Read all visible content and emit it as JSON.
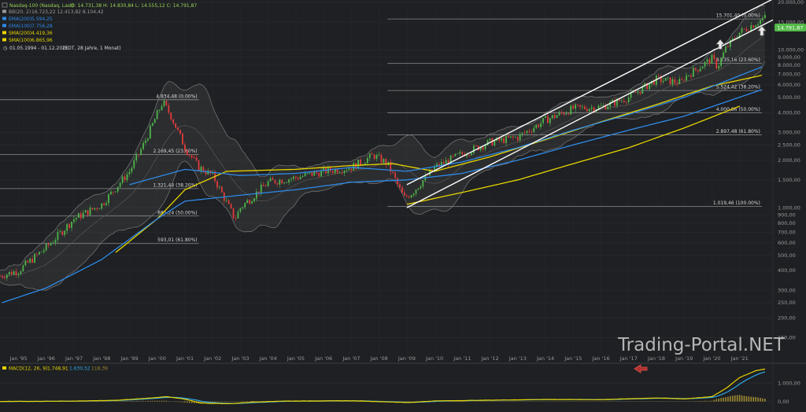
{
  "legend": {
    "title": "Nasdaq-100 (Nasdaq, Last)",
    "ohlc": "O: 14.731,38  H: 14.830,84  L: 14.555,12  C: 14.791,87",
    "indicators": [
      {
        "label": "BB(20, 2)",
        "value": "16.723,22  12.413,82  8.104,42",
        "color": "#9a9a9a"
      },
      {
        "label": "EMA(200)",
        "value": "5.594,25",
        "color": "#2f8ae8"
      },
      {
        "label": "EMA(100)",
        "value": "7.756,28",
        "color": "#2f8ae8"
      },
      {
        "label": "SMA(200)",
        "value": "4.419,36",
        "color": "#e8d400"
      },
      {
        "label": "SMA(100)",
        "value": "6.865,96",
        "color": "#e8d400"
      }
    ],
    "period": "01.05.1994 - 01.12.2021",
    "period_note": "(EDT, 28 Jahre, 1 Monat)"
  },
  "last_price": "14.791,87",
  "watermark": "Trading-Portal.NET",
  "macd": {
    "label": "MACD(12, 26, 9)",
    "macd_value": "1.748,91",
    "signal_value": "1.630,52",
    "hist_value": "118,39",
    "axis": [
      {
        "label": "1.000,00",
        "value": 1000
      },
      {
        "label": "0,00",
        "value": 0
      }
    ],
    "ylim": [
      -400,
      1900
    ]
  },
  "chart_data": {
    "type": "candlestick",
    "scale": "log",
    "ylim": [
      120,
      20000
    ],
    "xlim": [
      1994.33,
      2022.2
    ],
    "x_ticks": [
      "Jan '95",
      "Jan '96",
      "Jan '97",
      "Jan '98",
      "Jan '99",
      "Jan '00",
      "Jan '01",
      "Jan '02",
      "Jan '03",
      "Jan '04",
      "Jan '05",
      "Jan '06",
      "Jan '07",
      "Jan '08",
      "Jan '09",
      "Jan '10",
      "Jan '11",
      "Jan '12",
      "Jan '13",
      "Jan '14",
      "Jan '15",
      "Jan '16",
      "Jan '17",
      "Jan '18",
      "Jan '19",
      "Jan '20",
      "Jan '21"
    ],
    "y_ticks": [
      {
        "label": "20.000,00",
        "value": 20000
      },
      {
        "label": "15.000,00",
        "value": 15000
      },
      {
        "label": "10.000,00",
        "value": 10000
      },
      {
        "label": "9.000,00",
        "value": 9000
      },
      {
        "label": "8.000,00",
        "value": 8000
      },
      {
        "label": "7.000,00",
        "value": 7000
      },
      {
        "label": "6.000,00",
        "value": 6000
      },
      {
        "label": "5.000,00",
        "value": 5000
      },
      {
        "label": "4.000,00",
        "value": 4000
      },
      {
        "label": "3.000,00",
        "value": 3000
      },
      {
        "label": "2.500,00",
        "value": 2500
      },
      {
        "label": "2.000,00",
        "value": 2000
      },
      {
        "label": "1.500,00",
        "value": 1500
      },
      {
        "label": "1.000,00",
        "value": 1000
      },
      {
        "label": "900,00",
        "value": 900
      },
      {
        "label": "800,00",
        "value": 800
      },
      {
        "label": "700,00",
        "value": 700
      },
      {
        "label": "600,00",
        "value": 600
      },
      {
        "label": "500,00",
        "value": 500
      },
      {
        "label": "400,00",
        "value": 400
      },
      {
        "label": "300,00",
        "value": 300
      },
      {
        "label": "250,00",
        "value": 250
      },
      {
        "label": "200,00",
        "value": 200
      },
      {
        "label": "150,00",
        "value": 150
      }
    ],
    "fib_sets": [
      {
        "start": 1994.33,
        "end": 2001.5,
        "levels": [
          {
            "label": "4.834,48 (0.00%)",
            "value": 4834.48
          },
          {
            "label": "2.169,45 (23.60%)",
            "value": 2169.45
          },
          {
            "label": "1.321,48 (38.20%)",
            "value": 1321.48
          },
          {
            "label": "885,24 (50.00%)",
            "value": 885.24
          },
          {
            "label": "593,01 (61.80%)",
            "value": 593.01
          }
        ]
      },
      {
        "start": 2008.3,
        "end": 2021.8,
        "levels": [
          {
            "label": "15.701,40 (0.00%)",
            "value": 15701.4
          },
          {
            "label": "8.235,16 (23.60%)",
            "value": 8235.16
          },
          {
            "label": "5.524,42 (38.20%)",
            "value": 5524.42
          },
          {
            "label": "4.000,86 (50.00%)",
            "value": 4000.86
          },
          {
            "label": "2.897,48 (61.80%)",
            "value": 2897.48
          },
          {
            "label": "1.019,46 (100.00%)",
            "value": 1019.46
          }
        ]
      }
    ],
    "price_path": [
      [
        1994.33,
        370
      ],
      [
        1995,
        400
      ],
      [
        1996,
        560
      ],
      [
        1997,
        850
      ],
      [
        1998,
        1050
      ],
      [
        1999,
        1700
      ],
      [
        1999.5,
        2500
      ],
      [
        2000.2,
        4700
      ],
      [
        2000.5,
        3800
      ],
      [
        2001,
        2400
      ],
      [
        2001.5,
        1800
      ],
      [
        2002,
        1600
      ],
      [
        2002.8,
        850
      ],
      [
        2003,
        1000
      ],
      [
        2004,
        1450
      ],
      [
        2005,
        1550
      ],
      [
        2006,
        1700
      ],
      [
        2007,
        1800
      ],
      [
        2007.8,
        2150
      ],
      [
        2008.3,
        1900
      ],
      [
        2008.9,
        1150
      ],
      [
        2009.2,
        1250
      ],
      [
        2010,
        1800
      ],
      [
        2011,
        2200
      ],
      [
        2012,
        2600
      ],
      [
        2013,
        2800
      ],
      [
        2014,
        3600
      ],
      [
        2015,
        4250
      ],
      [
        2016,
        4350
      ],
      [
        2017,
        5000
      ],
      [
        2018,
        6500
      ],
      [
        2018.9,
        6200
      ],
      [
        2019,
        6700
      ],
      [
        2020,
        8800
      ],
      [
        2020.2,
        7800
      ],
      [
        2020.5,
        10200
      ],
      [
        2021,
        12900
      ],
      [
        2021.9,
        16000
      ]
    ],
    "series": [
      {
        "name": "SMA(200)",
        "color": "#e8d400",
        "points": [
          [
            2009,
            1050
          ],
          [
            2011,
            1250
          ],
          [
            2013,
            1500
          ],
          [
            2015,
            1900
          ],
          [
            2017,
            2400
          ],
          [
            2019,
            3200
          ],
          [
            2021,
            4400
          ]
        ]
      },
      {
        "name": "SMA(100)",
        "color": "#e8d400",
        "points": [
          [
            1998.5,
            520
          ],
          [
            2000,
            850
          ],
          [
            2001,
            1300
          ],
          [
            2002.5,
            1700
          ],
          [
            2005,
            1750
          ],
          [
            2007,
            1850
          ],
          [
            2008.5,
            1900
          ],
          [
            2010,
            1700
          ],
          [
            2012,
            2100
          ],
          [
            2014,
            2700
          ],
          [
            2016,
            3500
          ],
          [
            2018,
            4500
          ],
          [
            2020,
            5900
          ],
          [
            2021.8,
            6900
          ]
        ]
      },
      {
        "name": "EMA(200)",
        "color": "#2f8ae8",
        "points": [
          [
            1994.4,
            250
          ],
          [
            1996,
            310
          ],
          [
            1998,
            470
          ],
          [
            2000,
            850
          ],
          [
            2001,
            1100
          ],
          [
            2003,
            1200
          ],
          [
            2005,
            1300
          ],
          [
            2007,
            1450
          ],
          [
            2009,
            1500
          ],
          [
            2011,
            1650
          ],
          [
            2013,
            2000
          ],
          [
            2015,
            2500
          ],
          [
            2017,
            3100
          ],
          [
            2019,
            3800
          ],
          [
            2021.8,
            5600
          ]
        ]
      },
      {
        "name": "EMA(100)",
        "color": "#2f8ae8",
        "points": [
          [
            1999,
            1400
          ],
          [
            2001,
            1750
          ],
          [
            2003,
            1600
          ],
          [
            2005,
            1650
          ],
          [
            2007,
            1800
          ],
          [
            2009,
            1700
          ],
          [
            2011,
            1950
          ],
          [
            2013,
            2400
          ],
          [
            2015,
            3100
          ],
          [
            2017,
            3900
          ],
          [
            2019,
            5000
          ],
          [
            2021.8,
            7800
          ]
        ]
      }
    ],
    "channels": [
      {
        "name": "upper",
        "points": [
          [
            2009,
            1400
          ],
          [
            2022.2,
            21000
          ]
        ]
      },
      {
        "name": "lower",
        "points": [
          [
            2009,
            1000
          ],
          [
            2022.2,
            15500
          ]
        ]
      }
    ]
  }
}
